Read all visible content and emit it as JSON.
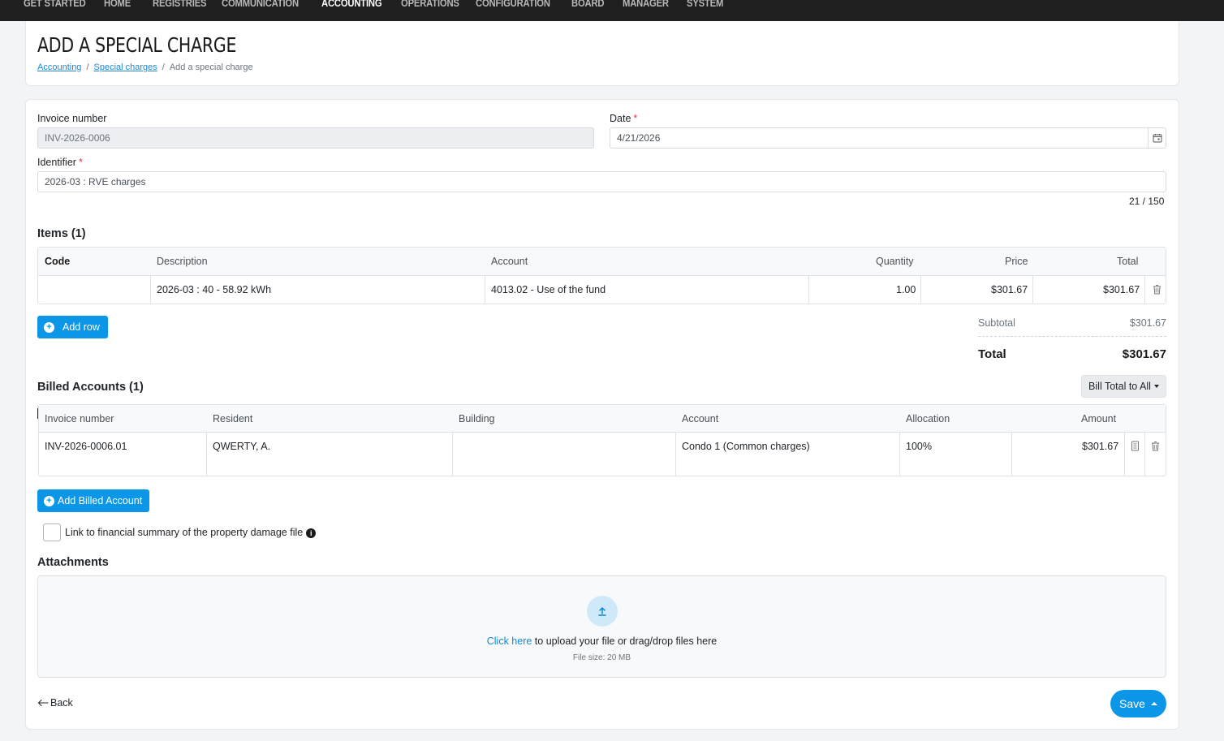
{
  "nav": {
    "items": [
      "GET STARTED",
      "HOME",
      "REGISTRIES",
      "COMMUNICATION",
      "ACCOUNTING",
      "OPERATIONS",
      "CONFIGURATION",
      "BOARD",
      "MANAGER",
      "SYSTEM"
    ],
    "active": "ACCOUNTING"
  },
  "header": {
    "title": "ADD A SPECIAL CHARGE",
    "breadcrumb": [
      "Accounting",
      "Special charges",
      "Add a special charge"
    ]
  },
  "form": {
    "invoice_number_label": "Invoice number",
    "invoice_number_value": "INV-2026-0006",
    "date_label": "Date",
    "date_value": "4/21/2026",
    "identifier_label": "Identifier",
    "identifier_value": "2026-03 : RVE charges",
    "identifier_counter": "21 / 150",
    "required_marker": "*"
  },
  "items": {
    "title": "Items (1)",
    "columns": [
      "Code",
      "Description",
      "Account",
      "Quantity",
      "Price",
      "Total"
    ],
    "rows": [
      {
        "code": "",
        "description": "2026-03 : 40 - 58.92 kWh",
        "account": "4013.02 - Use of the fund",
        "quantity": "1.00",
        "price": "$301.67",
        "total": "$301.67"
      }
    ],
    "add_row_label": "Add row",
    "subtotal_label": "Subtotal",
    "subtotal_value": "$301.67",
    "total_label": "Total",
    "total_value": "$301.67"
  },
  "billed": {
    "title": "Billed Accounts (1)",
    "bill_total_label": "Bill Total to All",
    "columns": [
      "Invoice number",
      "Resident",
      "Building",
      "Account",
      "Allocation",
      "Amount"
    ],
    "rows": [
      {
        "invoice": "INV-2026-0006.01",
        "resident": "QWERTY, A.",
        "building": "",
        "account": "Condo 1 (Common charges)",
        "allocation": "100%",
        "amount": "$301.67"
      }
    ],
    "add_label": "Add Billed Account"
  },
  "link_checkbox_label": "Link to financial summary of the property damage file",
  "attachments": {
    "title": "Attachments",
    "click_here": "Click here",
    "upload_text": " to upload your file or drag/drop files here",
    "file_size": "File size: 20 MB"
  },
  "footer": {
    "back_label": "Back",
    "save_label": "Save"
  },
  "colors": {
    "primary": "#0b96e8",
    "nav_bg": "#1f1f1f",
    "required": "#dc3545"
  }
}
